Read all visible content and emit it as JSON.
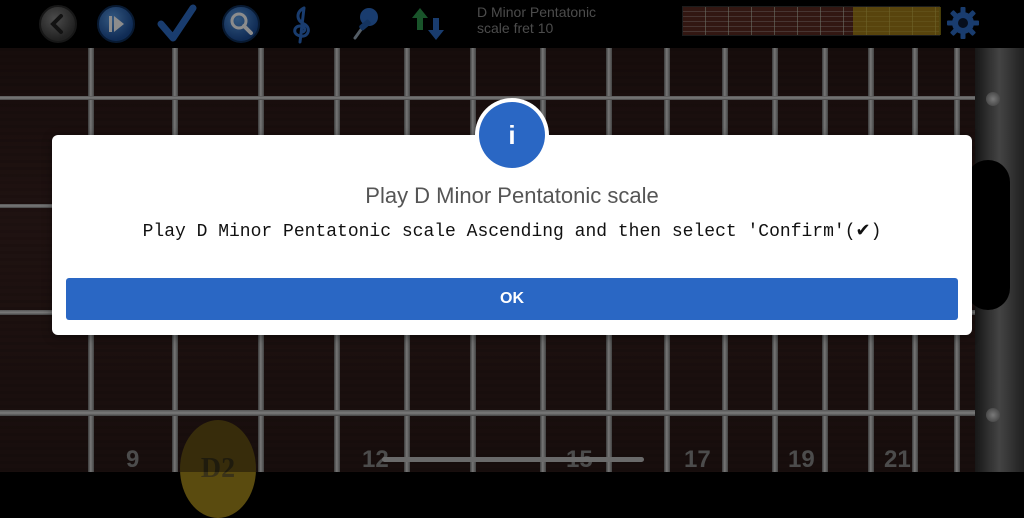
{
  "toolbar": {
    "icons": [
      "back-icon",
      "play-icon",
      "check-icon",
      "search-icon",
      "treble-clef-icon",
      "pin-icon",
      "sort-arrows-icon",
      "gear-icon"
    ],
    "scale_title_line1": "D Minor Pentatonic",
    "scale_title_line2": "scale fret 10"
  },
  "fretboard": {
    "fret_numbers": [
      "9",
      "12",
      "15",
      "17",
      "19",
      "21"
    ],
    "highlighted_note": "D2"
  },
  "dialog": {
    "icon_glyph": "i",
    "title": "Play D Minor Pentatonic scale",
    "message": "Play D Minor Pentatonic scale Ascending and then select 'Confirm'(✔)",
    "ok_label": "OK"
  },
  "colors": {
    "accent": "#2a67c4",
    "dialog_background": "#ffffff",
    "fret_number": "#8a8a8a",
    "highlight": "#c8aa14"
  }
}
